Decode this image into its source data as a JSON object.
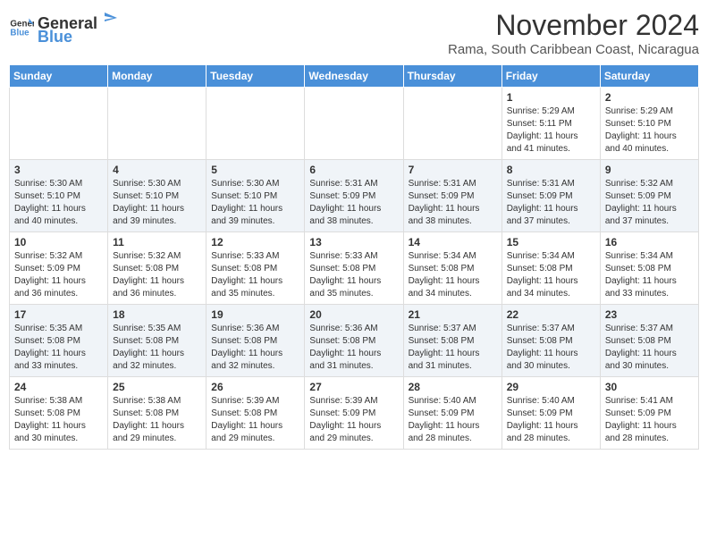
{
  "header": {
    "logo_general": "General",
    "logo_blue": "Blue",
    "month_title": "November 2024",
    "location": "Rama, South Caribbean Coast, Nicaragua"
  },
  "weekdays": [
    "Sunday",
    "Monday",
    "Tuesday",
    "Wednesday",
    "Thursday",
    "Friday",
    "Saturday"
  ],
  "weeks": [
    {
      "days": [
        {
          "num": "",
          "info": ""
        },
        {
          "num": "",
          "info": ""
        },
        {
          "num": "",
          "info": ""
        },
        {
          "num": "",
          "info": ""
        },
        {
          "num": "",
          "info": ""
        },
        {
          "num": "1",
          "info": "Sunrise: 5:29 AM\nSunset: 5:11 PM\nDaylight: 11 hours\nand 41 minutes."
        },
        {
          "num": "2",
          "info": "Sunrise: 5:29 AM\nSunset: 5:10 PM\nDaylight: 11 hours\nand 40 minutes."
        }
      ]
    },
    {
      "days": [
        {
          "num": "3",
          "info": "Sunrise: 5:30 AM\nSunset: 5:10 PM\nDaylight: 11 hours\nand 40 minutes."
        },
        {
          "num": "4",
          "info": "Sunrise: 5:30 AM\nSunset: 5:10 PM\nDaylight: 11 hours\nand 39 minutes."
        },
        {
          "num": "5",
          "info": "Sunrise: 5:30 AM\nSunset: 5:10 PM\nDaylight: 11 hours\nand 39 minutes."
        },
        {
          "num": "6",
          "info": "Sunrise: 5:31 AM\nSunset: 5:09 PM\nDaylight: 11 hours\nand 38 minutes."
        },
        {
          "num": "7",
          "info": "Sunrise: 5:31 AM\nSunset: 5:09 PM\nDaylight: 11 hours\nand 38 minutes."
        },
        {
          "num": "8",
          "info": "Sunrise: 5:31 AM\nSunset: 5:09 PM\nDaylight: 11 hours\nand 37 minutes."
        },
        {
          "num": "9",
          "info": "Sunrise: 5:32 AM\nSunset: 5:09 PM\nDaylight: 11 hours\nand 37 minutes."
        }
      ]
    },
    {
      "days": [
        {
          "num": "10",
          "info": "Sunrise: 5:32 AM\nSunset: 5:09 PM\nDaylight: 11 hours\nand 36 minutes."
        },
        {
          "num": "11",
          "info": "Sunrise: 5:32 AM\nSunset: 5:08 PM\nDaylight: 11 hours\nand 36 minutes."
        },
        {
          "num": "12",
          "info": "Sunrise: 5:33 AM\nSunset: 5:08 PM\nDaylight: 11 hours\nand 35 minutes."
        },
        {
          "num": "13",
          "info": "Sunrise: 5:33 AM\nSunset: 5:08 PM\nDaylight: 11 hours\nand 35 minutes."
        },
        {
          "num": "14",
          "info": "Sunrise: 5:34 AM\nSunset: 5:08 PM\nDaylight: 11 hours\nand 34 minutes."
        },
        {
          "num": "15",
          "info": "Sunrise: 5:34 AM\nSunset: 5:08 PM\nDaylight: 11 hours\nand 34 minutes."
        },
        {
          "num": "16",
          "info": "Sunrise: 5:34 AM\nSunset: 5:08 PM\nDaylight: 11 hours\nand 33 minutes."
        }
      ]
    },
    {
      "days": [
        {
          "num": "17",
          "info": "Sunrise: 5:35 AM\nSunset: 5:08 PM\nDaylight: 11 hours\nand 33 minutes."
        },
        {
          "num": "18",
          "info": "Sunrise: 5:35 AM\nSunset: 5:08 PM\nDaylight: 11 hours\nand 32 minutes."
        },
        {
          "num": "19",
          "info": "Sunrise: 5:36 AM\nSunset: 5:08 PM\nDaylight: 11 hours\nand 32 minutes."
        },
        {
          "num": "20",
          "info": "Sunrise: 5:36 AM\nSunset: 5:08 PM\nDaylight: 11 hours\nand 31 minutes."
        },
        {
          "num": "21",
          "info": "Sunrise: 5:37 AM\nSunset: 5:08 PM\nDaylight: 11 hours\nand 31 minutes."
        },
        {
          "num": "22",
          "info": "Sunrise: 5:37 AM\nSunset: 5:08 PM\nDaylight: 11 hours\nand 30 minutes."
        },
        {
          "num": "23",
          "info": "Sunrise: 5:37 AM\nSunset: 5:08 PM\nDaylight: 11 hours\nand 30 minutes."
        }
      ]
    },
    {
      "days": [
        {
          "num": "24",
          "info": "Sunrise: 5:38 AM\nSunset: 5:08 PM\nDaylight: 11 hours\nand 30 minutes."
        },
        {
          "num": "25",
          "info": "Sunrise: 5:38 AM\nSunset: 5:08 PM\nDaylight: 11 hours\nand 29 minutes."
        },
        {
          "num": "26",
          "info": "Sunrise: 5:39 AM\nSunset: 5:08 PM\nDaylight: 11 hours\nand 29 minutes."
        },
        {
          "num": "27",
          "info": "Sunrise: 5:39 AM\nSunset: 5:09 PM\nDaylight: 11 hours\nand 29 minutes."
        },
        {
          "num": "28",
          "info": "Sunrise: 5:40 AM\nSunset: 5:09 PM\nDaylight: 11 hours\nand 28 minutes."
        },
        {
          "num": "29",
          "info": "Sunrise: 5:40 AM\nSunset: 5:09 PM\nDaylight: 11 hours\nand 28 minutes."
        },
        {
          "num": "30",
          "info": "Sunrise: 5:41 AM\nSunset: 5:09 PM\nDaylight: 11 hours\nand 28 minutes."
        }
      ]
    }
  ]
}
